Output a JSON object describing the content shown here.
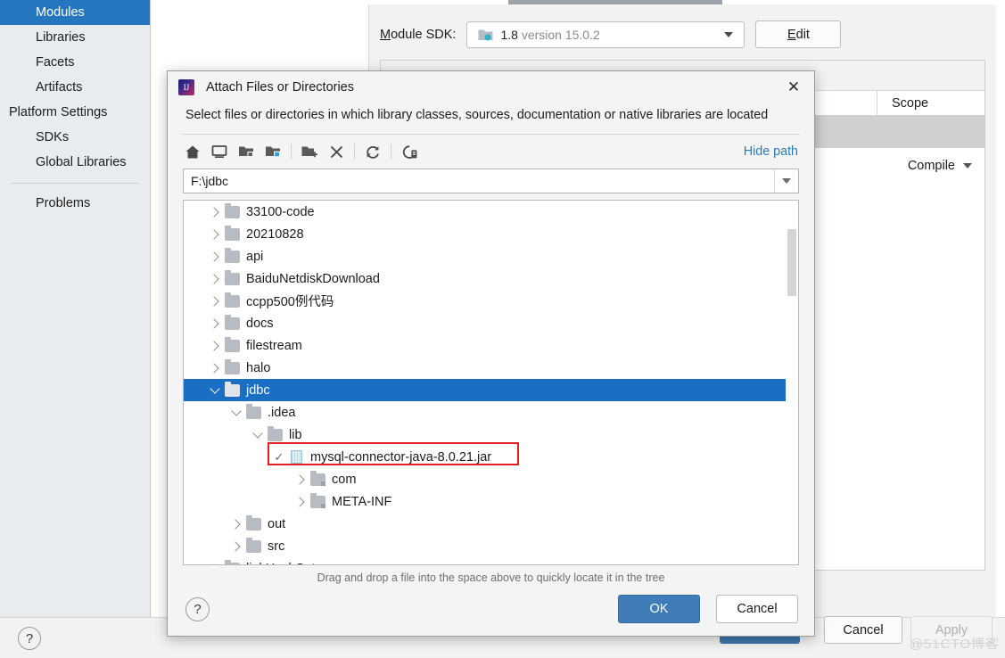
{
  "background": {
    "sidebar": {
      "items": [
        {
          "label": "Modules",
          "selected": true,
          "type": "item"
        },
        {
          "label": "Libraries",
          "selected": false,
          "type": "item"
        },
        {
          "label": "Facets",
          "selected": false,
          "type": "item"
        },
        {
          "label": "Artifacts",
          "selected": false,
          "type": "item"
        },
        {
          "label": "Platform Settings",
          "selected": false,
          "type": "header"
        },
        {
          "label": "SDKs",
          "selected": false,
          "type": "item"
        },
        {
          "label": "Global Libraries",
          "selected": false,
          "type": "item"
        },
        {
          "label": "Problems",
          "selected": false,
          "type": "item"
        }
      ]
    },
    "sdk": {
      "label": "Module SDK:",
      "label_mnemonic": "M",
      "label_rest": "odule SDK:",
      "value_name": "1.8",
      "value_version": "version 15.0.2",
      "edit_button": "Edit",
      "edit_mnemonic": "E",
      "edit_rest": "dit",
      "icon": "sdk-folder-icon"
    },
    "table": {
      "column_scope": "Scope",
      "scope_value": "Compile"
    },
    "footer": {
      "help_label": "?",
      "cancel_label": "Cancel",
      "apply_label": "Apply"
    },
    "watermark": "@51CTO博客"
  },
  "dialog": {
    "app_icon_label": "IJ",
    "title": "Attach Files or Directories",
    "close_label": "✕",
    "subtitle": "Select files or directories in which library classes, sources, documentation or native libraries are located",
    "toolbar": {
      "buttons": [
        {
          "name": "home-icon",
          "tip": "Home"
        },
        {
          "name": "desktop-icon",
          "tip": "Desktop"
        },
        {
          "name": "folder-project-icon",
          "tip": "Project"
        },
        {
          "name": "folder-module-icon",
          "tip": "Module"
        },
        {
          "name": "new-folder-icon",
          "tip": "New Folder"
        },
        {
          "name": "delete-icon",
          "tip": "Delete"
        },
        {
          "name": "refresh-icon",
          "tip": "Refresh"
        },
        {
          "name": "show-hidden-icon",
          "tip": "Show Hidden Files"
        }
      ],
      "hide_path_label": "Hide path"
    },
    "path": {
      "value": "F:\\jdbc",
      "placeholder": "F:\\jdbc"
    },
    "tree": [
      {
        "label": "33100-code",
        "depth": 1,
        "state": "collapsed",
        "icon": "folder",
        "selected": false,
        "partial": true
      },
      {
        "label": "20210828",
        "depth": 1,
        "state": "collapsed",
        "icon": "folder",
        "selected": false
      },
      {
        "label": "api",
        "depth": 1,
        "state": "collapsed",
        "icon": "folder",
        "selected": false
      },
      {
        "label": "BaiduNetdiskDownload",
        "depth": 1,
        "state": "collapsed",
        "icon": "folder",
        "selected": false
      },
      {
        "label": "ccpp500例代码",
        "depth": 1,
        "state": "collapsed",
        "icon": "folder",
        "selected": false
      },
      {
        "label": "docs",
        "depth": 1,
        "state": "collapsed",
        "icon": "folder",
        "selected": false
      },
      {
        "label": "filestream",
        "depth": 1,
        "state": "collapsed",
        "icon": "folder",
        "selected": false
      },
      {
        "label": "halo",
        "depth": 1,
        "state": "collapsed",
        "icon": "folder",
        "selected": false
      },
      {
        "label": "jdbc",
        "depth": 1,
        "state": "expanded",
        "icon": "folder",
        "selected": true
      },
      {
        "label": ".idea",
        "depth": 2,
        "state": "expanded",
        "icon": "folder",
        "selected": false
      },
      {
        "label": "lib",
        "depth": 3,
        "state": "expanded",
        "icon": "folder",
        "selected": false
      },
      {
        "label": "mysql-connector-java-8.0.21.jar",
        "depth": 4,
        "state": "checked",
        "icon": "jar",
        "selected": false,
        "highlighted": true
      },
      {
        "label": "com",
        "depth": 5,
        "state": "collapsed",
        "icon": "folder-sub",
        "selected": false
      },
      {
        "label": "META-INF",
        "depth": 5,
        "state": "collapsed",
        "icon": "folder-sub",
        "selected": false
      },
      {
        "label": "out",
        "depth": 2,
        "state": "collapsed",
        "icon": "folder",
        "selected": false
      },
      {
        "label": "src",
        "depth": 2,
        "state": "collapsed",
        "icon": "folder",
        "selected": false
      },
      {
        "label": "linkHashSet",
        "depth": 1,
        "state": "collapsed",
        "icon": "folder",
        "selected": false,
        "partial": true
      }
    ],
    "drag_hint": "Drag and drop a file into the space above to quickly locate it in the tree",
    "footer": {
      "help_label": "?",
      "ok_label": "OK",
      "cancel_label": "Cancel"
    }
  },
  "colors": {
    "accent_blue": "#1a6fc4",
    "sidebar_selected": "#2675bf",
    "ok_button": "#3f7cb8",
    "link": "#2a7bbd",
    "highlight_red": "#e02020"
  }
}
